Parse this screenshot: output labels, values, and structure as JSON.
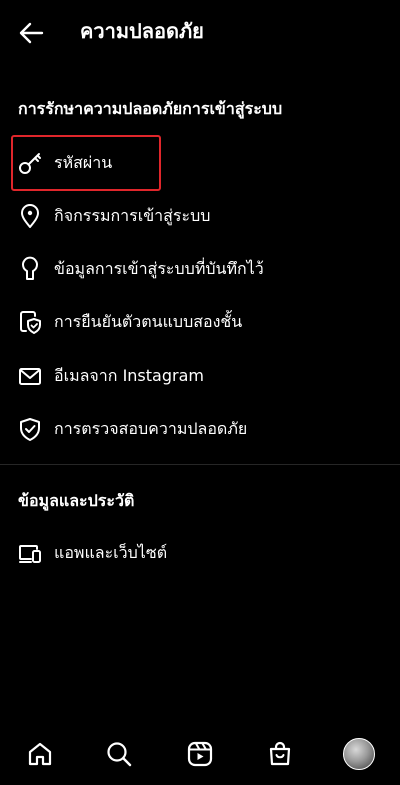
{
  "header": {
    "title": "ความปลอดภัย",
    "back_icon": "arrow-left-icon"
  },
  "sections": {
    "login_security": {
      "title": "การรักษาความปลอดภัยการเข้าสู่ระบบ",
      "items": [
        {
          "label": "รหัสผ่าน",
          "icon": "key-icon"
        },
        {
          "label": "กิจกรรมการเข้าสู่ระบบ",
          "icon": "location-pin-icon"
        },
        {
          "label": "ข้อมูลการเข้าสู่ระบบที่บันทึกไว้",
          "icon": "keyhole-icon"
        },
        {
          "label": "การยืนยันตัวตนแบบสองชั้น",
          "icon": "phone-shield-icon"
        },
        {
          "label": "อีเมลจาก Instagram",
          "icon": "mail-icon"
        },
        {
          "label": "การตรวจสอบความปลอดภัย",
          "icon": "shield-check-icon"
        }
      ]
    },
    "data_history": {
      "title": "ข้อมูลและประวัติ",
      "items": [
        {
          "label": "แอพและเว็บไซต์",
          "icon": "devices-icon"
        }
      ]
    }
  },
  "highlight_color": "#e0262b",
  "bottom_nav": [
    {
      "icon": "home-icon"
    },
    {
      "icon": "search-icon"
    },
    {
      "icon": "reels-icon"
    },
    {
      "icon": "shop-icon"
    },
    {
      "icon": "profile-avatar"
    }
  ]
}
